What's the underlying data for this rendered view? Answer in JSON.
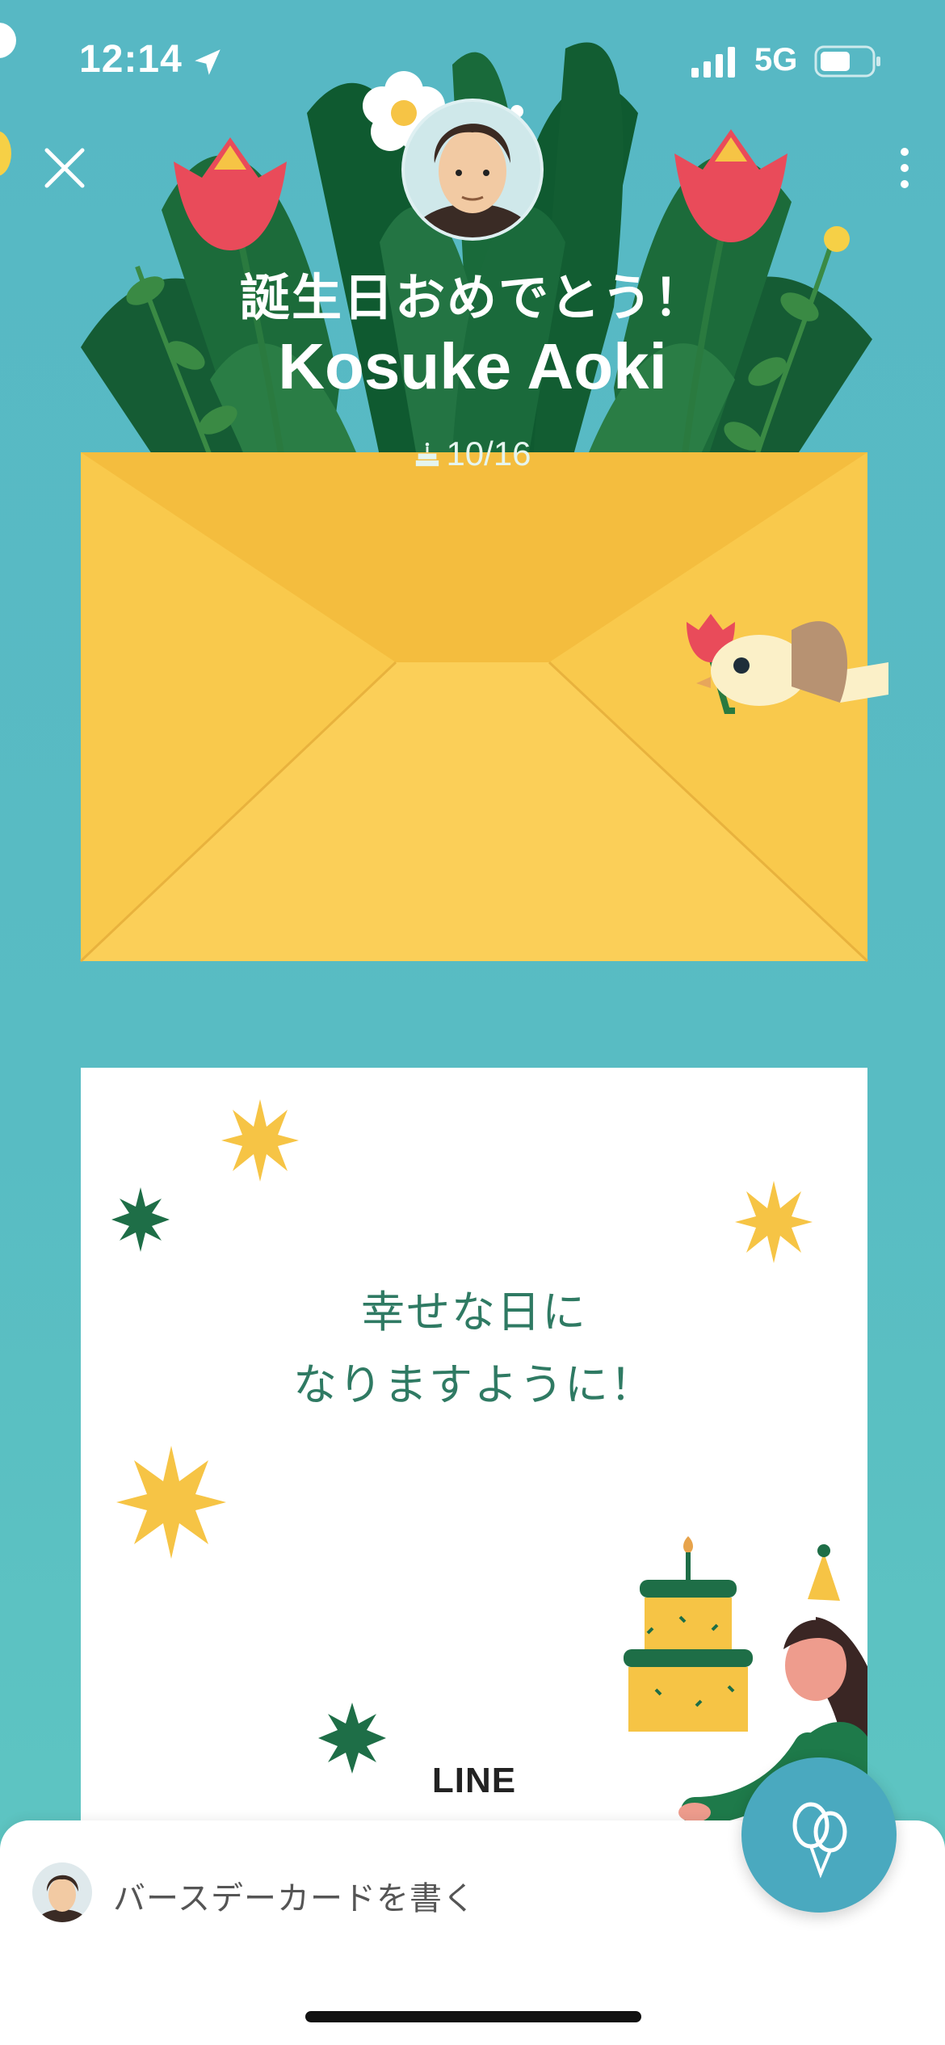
{
  "status_bar": {
    "time": "12:14",
    "network": "5G"
  },
  "header": {
    "greeting": "誕生日おめでとう！",
    "name": "Kosuke Aoki",
    "birthday": "10/16"
  },
  "card": {
    "message_line1": "幸せな日に",
    "message_line2": "なりますように！",
    "brand": "LINE"
  },
  "composer": {
    "placeholder": "バースデーカードを書く"
  },
  "icons": {
    "close": "close-icon",
    "more": "more-vertical-icon",
    "cake": "cake-icon",
    "balloon": "balloon-icon",
    "location": "location-arrow-icon"
  },
  "colors": {
    "background": "#57b8c4",
    "envelope": "#f9c94c",
    "leaf": "#1e6e3c",
    "tulip": "#e94b5a",
    "card_text": "#2f7a63",
    "fab": "#4aa9bf"
  }
}
